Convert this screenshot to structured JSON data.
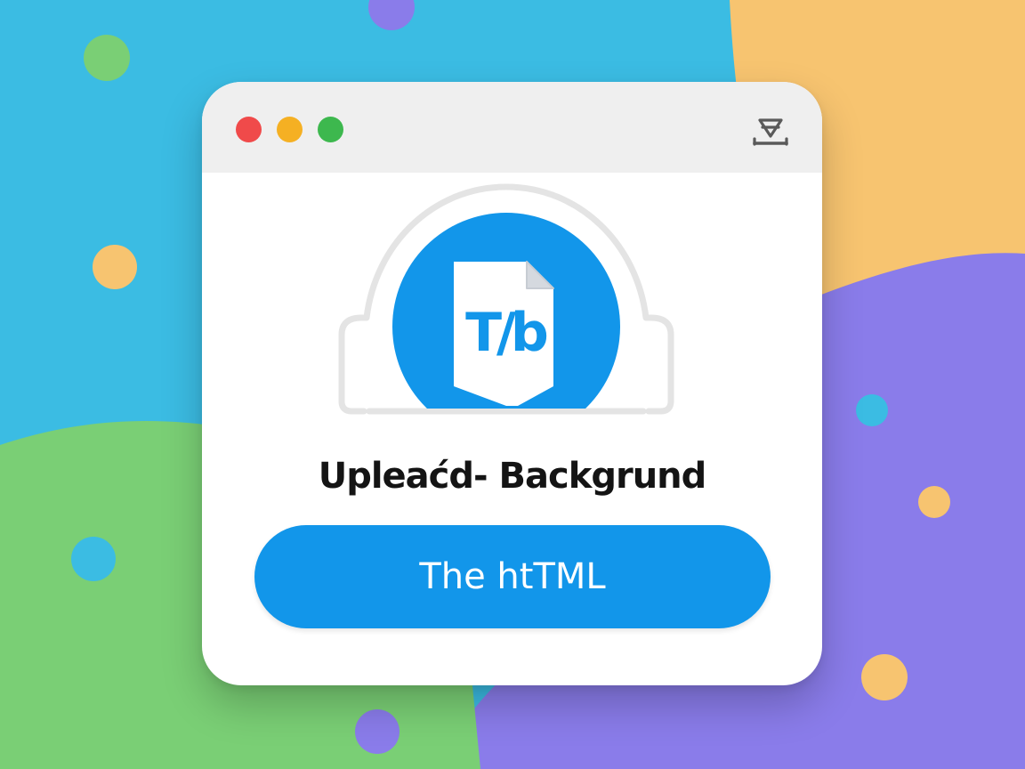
{
  "window": {
    "controls": [
      "close",
      "minimize",
      "maximize"
    ],
    "title_icon": "download-tray-icon"
  },
  "hero": {
    "icon": "document-logo-icon",
    "logo_text": "T/b"
  },
  "heading": "Upleaćd- Backgrund",
  "cta_label": "The htTML",
  "colors": {
    "accent": "#1296EA",
    "close": "#F04A4A",
    "minimize": "#F5B023",
    "maximize": "#3DB84E",
    "bg_blue": "#3BBCE3",
    "bg_green": "#7ACF75",
    "bg_orange": "#F7C470",
    "bg_purple": "#8A7CEA"
  }
}
